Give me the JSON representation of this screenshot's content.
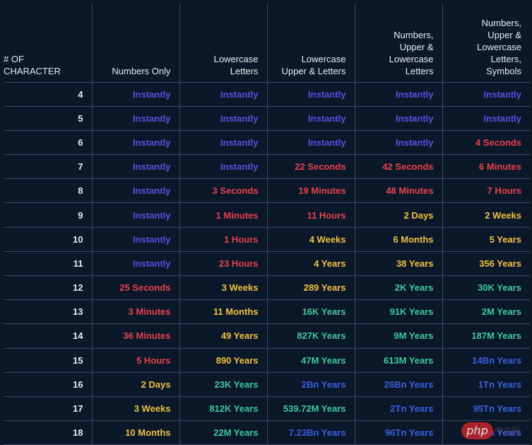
{
  "table": {
    "headers": [
      "# OF\nCHARACTER",
      "Numbers Only",
      "Lowercase Letters",
      "Lowercase Upper & Letters",
      "Numbers, Upper & Lowercase Letters",
      "Numbers, Upper & Lowercase Letters, Symbols"
    ],
    "header_lines": [
      [
        "# OF",
        "CHARACTER"
      ],
      [
        "Numbers Only"
      ],
      [
        "Lowercase",
        "Letters"
      ],
      [
        "Lowercase",
        "Upper & Letters"
      ],
      [
        "Numbers,",
        "Upper &",
        "Lowercase",
        "Letters"
      ],
      [
        "Numbers,",
        "Upper &",
        "Lowercase",
        "Letters,",
        "Symbols"
      ]
    ],
    "rows": [
      {
        "chars": "4",
        "cells": [
          [
            "Instantly",
            "instant"
          ],
          [
            "Instantly",
            "instant"
          ],
          [
            "Instantly",
            "instant"
          ],
          [
            "Instantly",
            "instant"
          ],
          [
            "Instantly",
            "instant"
          ]
        ]
      },
      {
        "chars": "5",
        "cells": [
          [
            "Instantly",
            "instant"
          ],
          [
            "Instantly",
            "instant"
          ],
          [
            "Instantly",
            "instant"
          ],
          [
            "Instantly",
            "instant"
          ],
          [
            "Instantly",
            "instant"
          ]
        ]
      },
      {
        "chars": "6",
        "cells": [
          [
            "Instantly",
            "instant"
          ],
          [
            "Instantly",
            "instant"
          ],
          [
            "Instantly",
            "instant"
          ],
          [
            "Instantly",
            "instant"
          ],
          [
            "4 Seconds",
            "red"
          ]
        ]
      },
      {
        "chars": "7",
        "cells": [
          [
            "Instantly",
            "instant"
          ],
          [
            "Instantly",
            "instant"
          ],
          [
            "22 Seconds",
            "red"
          ],
          [
            "42 Seconds",
            "red"
          ],
          [
            "6 Minutes",
            "red"
          ]
        ]
      },
      {
        "chars": "8",
        "cells": [
          [
            "Instantly",
            "instant"
          ],
          [
            "3 Seconds",
            "red"
          ],
          [
            "19 Minutes",
            "red"
          ],
          [
            "48 Minutes",
            "red"
          ],
          [
            "7 Hours",
            "red"
          ]
        ]
      },
      {
        "chars": "9",
        "cells": [
          [
            "Instantly",
            "instant"
          ],
          [
            "1 Minutes",
            "red"
          ],
          [
            "11 Hours",
            "red"
          ],
          [
            "2 Days",
            "amber"
          ],
          [
            "2 Weeks",
            "amber"
          ]
        ]
      },
      {
        "chars": "10",
        "cells": [
          [
            "Instantly",
            "instant"
          ],
          [
            "1 Hours",
            "red"
          ],
          [
            "4 Weeks",
            "amber"
          ],
          [
            "6 Months",
            "amber"
          ],
          [
            "5 Years",
            "amber"
          ]
        ]
      },
      {
        "chars": "11",
        "cells": [
          [
            "Instantly",
            "instant"
          ],
          [
            "23 Hours",
            "red"
          ],
          [
            "4 Years",
            "amber"
          ],
          [
            "38 Years",
            "amber"
          ],
          [
            "356 Years",
            "amber"
          ]
        ]
      },
      {
        "chars": "12",
        "cells": [
          [
            "25 Seconds",
            "red"
          ],
          [
            "3 Weeks",
            "amber"
          ],
          [
            "289 Years",
            "amber"
          ],
          [
            "2K Years",
            "green"
          ],
          [
            "30K Years",
            "green"
          ]
        ]
      },
      {
        "chars": "13",
        "cells": [
          [
            "3 Minutes",
            "red"
          ],
          [
            "11 Months",
            "amber"
          ],
          [
            "16K Years",
            "green"
          ],
          [
            "91K Years",
            "green"
          ],
          [
            "2M Years",
            "green"
          ]
        ]
      },
      {
        "chars": "14",
        "cells": [
          [
            "36 Minutes",
            "red"
          ],
          [
            "49 Years",
            "amber"
          ],
          [
            "827K Years",
            "green"
          ],
          [
            "9M Years",
            "green"
          ],
          [
            "187M Years",
            "green"
          ]
        ]
      },
      {
        "chars": "15",
        "cells": [
          [
            "5 Hours",
            "red"
          ],
          [
            "890 Years",
            "amber"
          ],
          [
            "47M Years",
            "green"
          ],
          [
            "613M Years",
            "green"
          ],
          [
            "14Bn Years",
            "blue"
          ]
        ]
      },
      {
        "chars": "16",
        "cells": [
          [
            "2 Days",
            "amber"
          ],
          [
            "23K Years",
            "green"
          ],
          [
            "2Bn Years",
            "blue"
          ],
          [
            "26Bn Years",
            "blue"
          ],
          [
            "1Tn Years",
            "blue"
          ]
        ]
      },
      {
        "chars": "17",
        "cells": [
          [
            "3 Weeks",
            "amber"
          ],
          [
            "812K Years",
            "green"
          ],
          [
            "539.72M Years",
            "green"
          ],
          [
            "2Tn Years",
            "blue"
          ],
          [
            "95Tn Years",
            "blue"
          ]
        ]
      },
      {
        "chars": "18",
        "cells": [
          [
            "10 Months",
            "amber"
          ],
          [
            "22M Years",
            "green"
          ],
          [
            "7.23Bn Years",
            "blue"
          ],
          [
            "96Tn Years",
            "blue"
          ],
          [
            "6Qn Years",
            "blue"
          ]
        ]
      }
    ]
  },
  "colors": {
    "background": "#0b1829",
    "instant": "#5b4fe0",
    "red": "#e5424d",
    "amber": "#f0c043",
    "green": "#3fc8a0",
    "blue": "#3a5ee0"
  },
  "watermark": {
    "label": "php",
    "suffix": "中文网"
  }
}
